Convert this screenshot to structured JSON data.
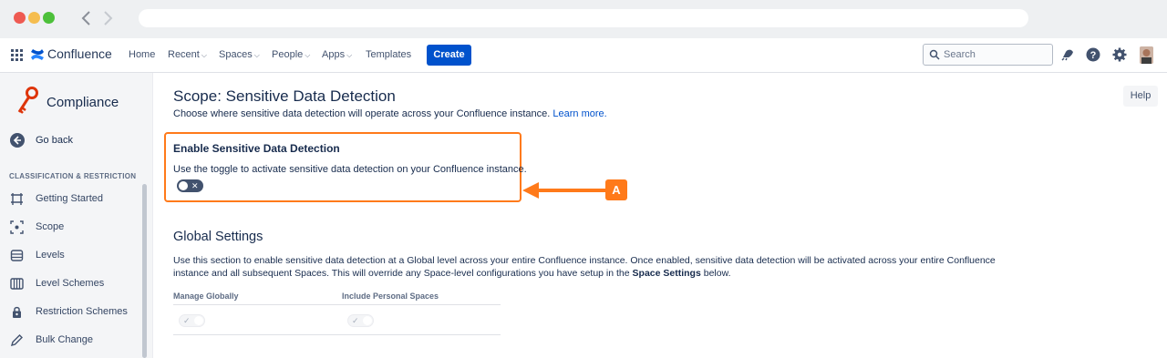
{
  "app": {
    "name": "Confluence"
  },
  "topnav": {
    "items": [
      {
        "label": "Home"
      },
      {
        "label": "Recent"
      },
      {
        "label": "Spaces"
      },
      {
        "label": "People"
      },
      {
        "label": "Apps"
      },
      {
        "label": "Templates"
      }
    ],
    "create_label": "Create",
    "search_placeholder": "Search"
  },
  "sidebar": {
    "title": "Compliance",
    "back_label": "Go back",
    "section_label": "CLASSIFICATION & RESTRICTION",
    "items": [
      {
        "label": "Getting Started",
        "icon": "flag-icon"
      },
      {
        "label": "Scope",
        "icon": "scope-icon"
      },
      {
        "label": "Levels",
        "icon": "levels-icon"
      },
      {
        "label": "Level Schemes",
        "icon": "level-schemes-icon"
      },
      {
        "label": "Restriction Schemes",
        "icon": "lock-icon"
      },
      {
        "label": "Bulk Change",
        "icon": "pencil-icon"
      }
    ]
  },
  "main": {
    "title": "Scope: Sensitive Data Detection",
    "description": "Choose where sensitive data detection will operate across your Confluence instance.",
    "learn_more": "Learn more.",
    "help_label": "Help",
    "enable_section": {
      "title": "Enable Sensitive Data Detection",
      "description": "Use the toggle to activate sensitive data detection on your Confluence instance.",
      "toggle_state": "off"
    },
    "callout_label": "A",
    "global_settings": {
      "title": "Global Settings",
      "description_part1": "Use this section to enable sensitive data detection at a Global level across your entire Confluence instance. Once enabled, sensitive data detection will be activated across your entire Confluence instance and all subsequent Spaces. This will override any Space-level configurations you have setup in the ",
      "description_bold": "Space Settings",
      "description_part2": " below.",
      "columns": [
        {
          "label": "Manage Globally"
        },
        {
          "label": "Include Personal Spaces"
        }
      ]
    }
  },
  "colors": {
    "accent": "#0052cc",
    "annotation": "#ff7a1a"
  }
}
